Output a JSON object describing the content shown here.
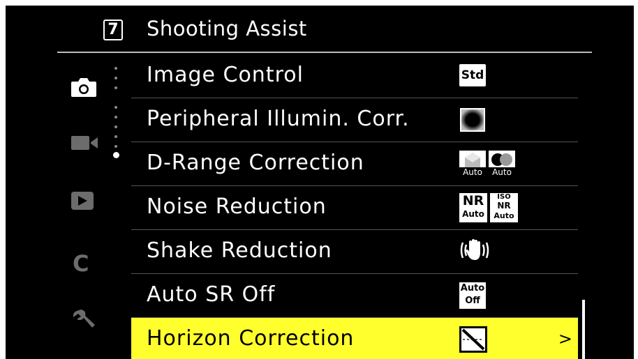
{
  "header": {
    "page_number": "7",
    "title": "Shooting Assist"
  },
  "side_tabs": [
    {
      "name": "camera-tab-icon",
      "active": true
    },
    {
      "name": "video-tab-icon",
      "active": false
    },
    {
      "name": "playback-tab-icon",
      "active": false
    },
    {
      "name": "custom-tab-icon",
      "label": "C",
      "active": false
    },
    {
      "name": "setup-wrench-icon",
      "active": false
    }
  ],
  "menu_items": [
    {
      "label": "Image Control",
      "setting": "Std"
    },
    {
      "label": "Peripheral Illumin. Corr.",
      "setting": "peripheral-illumination-icon"
    },
    {
      "label": "D-Range Correction",
      "setting_labels": [
        "Auto",
        "Auto"
      ]
    },
    {
      "label": "Noise Reduction",
      "setting_labels": [
        "NR",
        "Auto",
        "ISO",
        "NR",
        "Auto"
      ]
    },
    {
      "label": "Shake Reduction",
      "setting": "shake-reduction-icon"
    },
    {
      "label": "Auto SR Off",
      "setting_labels": [
        "Auto",
        "Off"
      ]
    },
    {
      "label": "Horizon Correction",
      "setting": "horizon-correction-icon",
      "selected": true,
      "chevron": ">"
    }
  ],
  "colors": {
    "background": "#000000",
    "selection": "#ffff2e",
    "text": "#ffffff"
  }
}
